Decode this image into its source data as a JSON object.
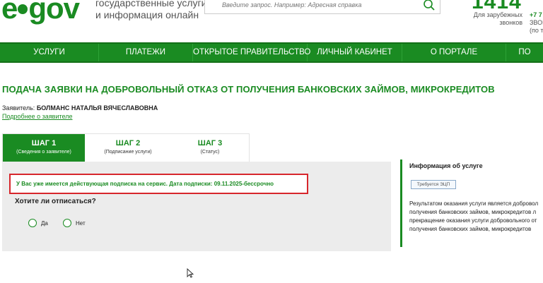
{
  "header": {
    "logo_e": "e",
    "logo_gov": "gov",
    "tagline_line1": "государственные услуги",
    "tagline_line2": "и информация онлайн",
    "search_placeholder": "Введите запрос. Например: Адресная справка",
    "phone_big": "1414",
    "phone_note_line1": "Для зарубежных",
    "phone_note_line2": "звонков",
    "phone_small_line1": "+7 7",
    "phone_small_line2": "ЗВОН",
    "phone_small_line3": "(по т"
  },
  "nav": {
    "items": [
      {
        "label": "УСЛУГИ"
      },
      {
        "label": "ПЛАТЕЖИ"
      },
      {
        "label": "ОТКРЫТОЕ ПРАВИТЕЛЬСТВО"
      },
      {
        "label": "ЛИЧНЫЙ КАБИНЕТ"
      },
      {
        "label": "О ПОРТАЛЕ"
      },
      {
        "label": "ПО"
      }
    ]
  },
  "main": {
    "title": "ПОДАЧА ЗАЯВКИ НА ДОБРОВОЛЬНЫЙ ОТКАЗ ОТ ПОЛУЧЕНИЯ БАНКОВСКИХ ЗАЙМОВ, МИКРОКРЕДИТОВ",
    "applicant_label": "Заявитель:",
    "applicant_name": "БОЛМАНС НАТАЛЬЯ ВЯЧЕСЛАВОВНА",
    "more_link": "Подробнее о заявителе",
    "steps": [
      {
        "num": "ШАГ 1",
        "sub": "(Сведения о заявителе)"
      },
      {
        "num": "ШАГ 2",
        "sub": "(Подписание услуги)"
      },
      {
        "num": "ШАГ 3",
        "sub": "(Статус)"
      }
    ],
    "alert": "У Вас уже имеется действующая подписка на сервис. Дата подписки: 09.11.2025-бессрочно",
    "question": "Хотите ли отписаться?",
    "options": [
      {
        "label": "Да"
      },
      {
        "label": "Нет"
      }
    ]
  },
  "info": {
    "title": "Информация об услуге",
    "badge": "Требуется ЭЦП",
    "text_lines": [
      "Результатом оказания услуги является добровол",
      "получения банковских займов, микрокредитов л",
      "прекращение оказания услуги добровольного от",
      "получения банковских займов, микрокредитов"
    ]
  },
  "colors": {
    "brand_green": "#1a8b22",
    "alert_border": "#d7262c",
    "panel_bg": "#ececec"
  }
}
